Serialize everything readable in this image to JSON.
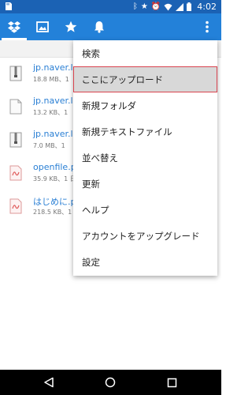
{
  "status_bar": {
    "time": "4:02",
    "icons": [
      "bluetooth-icon",
      "star-icon",
      "alarm-icon",
      "wifi-icon",
      "signal-icon",
      "battery-icon"
    ],
    "glyphs": {
      "bluetooth": "ᛒ",
      "star": "★",
      "alarm": "⏰"
    }
  },
  "toolbar": {
    "tabs": [
      {
        "icon": "dropbox-icon",
        "active": true
      },
      {
        "icon": "photos-icon",
        "active": false
      },
      {
        "icon": "favorites-star-icon",
        "active": false
      },
      {
        "icon": "notifications-bell-icon",
        "active": false
      }
    ],
    "overflow_icon": "more-vert-icon",
    "color": "#2381d9",
    "status_color": "#1b62b4"
  },
  "files": [
    {
      "name": "jp.naver.lin",
      "meta": "18.8 MB、1",
      "icon": "archive-file-icon"
    },
    {
      "name": "jp.naver.lin",
      "meta": "13.2 KB、1",
      "icon": "document-file-icon"
    },
    {
      "name": "jp.naver.lin",
      "meta": "7.0 MB、1",
      "icon": "archive-file-icon"
    },
    {
      "name": "openfile.pd",
      "meta": "35.9 KB、1 日",
      "icon": "pdf-file-icon"
    },
    {
      "name": "はじめに.p",
      "meta": "218.5 KB、1",
      "icon": "pdf-file-icon"
    }
  ],
  "menu": {
    "items": [
      {
        "label": "検索",
        "highlighted": false
      },
      {
        "label": "ここにアップロード",
        "highlighted": true
      },
      {
        "label": "新規フォルダ",
        "highlighted": false
      },
      {
        "label": "新規テキストファイル",
        "highlighted": false
      },
      {
        "label": "並べ替え",
        "highlighted": false
      },
      {
        "label": "更新",
        "highlighted": false
      },
      {
        "label": "ヘルプ",
        "highlighted": false
      },
      {
        "label": "アカウントをアップグレード",
        "highlighted": false
      },
      {
        "label": "設定",
        "highlighted": false
      }
    ],
    "highlight_border_color": "#d9444f"
  },
  "nav_bar": {
    "buttons": [
      "back-icon",
      "home-icon",
      "recents-icon"
    ]
  }
}
